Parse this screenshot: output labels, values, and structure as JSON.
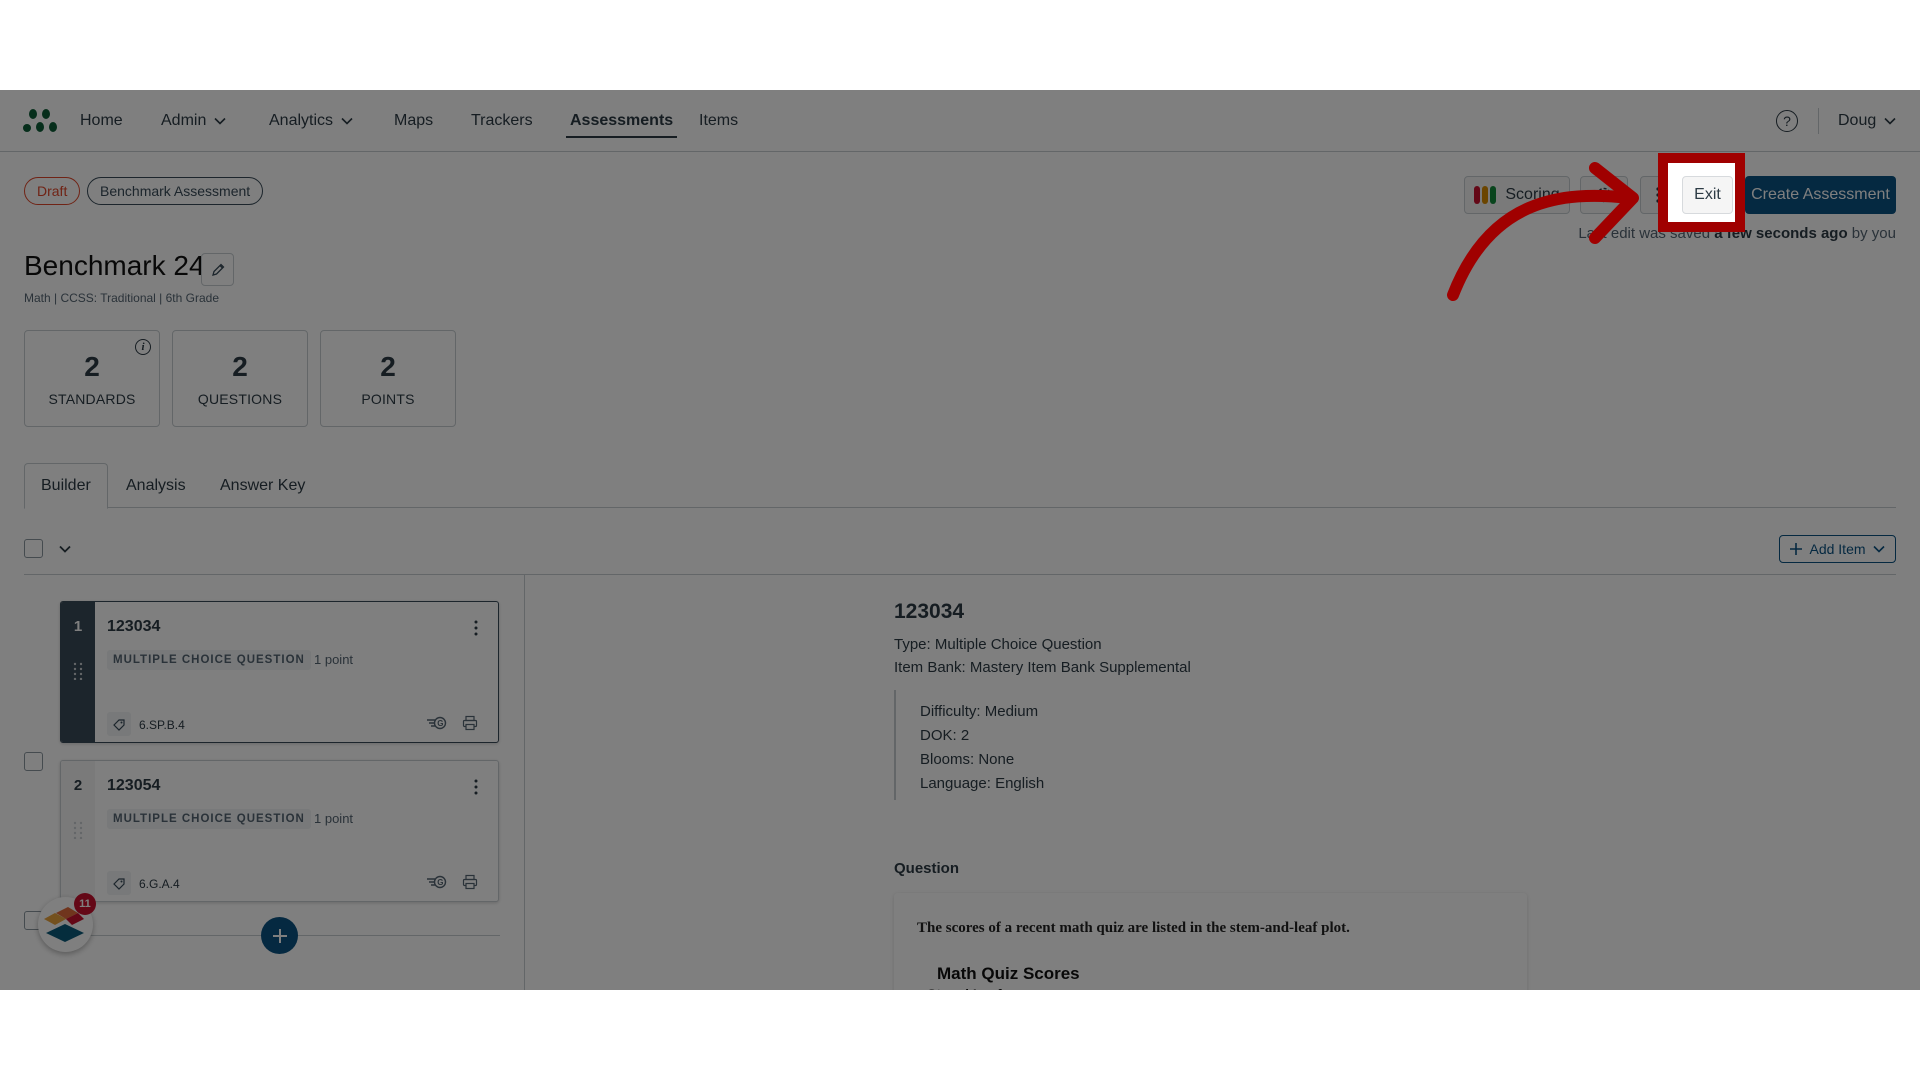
{
  "nav": {
    "items": [
      {
        "label": "Home",
        "has_dropdown": false,
        "active": false
      },
      {
        "label": "Admin",
        "has_dropdown": true,
        "active": false
      },
      {
        "label": "Analytics",
        "has_dropdown": true,
        "active": false
      },
      {
        "label": "Maps",
        "has_dropdown": false,
        "active": false
      },
      {
        "label": "Trackers",
        "has_dropdown": false,
        "active": false
      },
      {
        "label": "Assessments",
        "has_dropdown": false,
        "active": true
      },
      {
        "label": "Items",
        "has_dropdown": false,
        "active": false
      }
    ],
    "help_icon": "?",
    "user": "Doug",
    "brand_color": "#0d5c36"
  },
  "header": {
    "status_badge": "Draft",
    "type_badge": "Benchmark Assessment",
    "title": "Benchmark 24",
    "subtitle": "Math  |  CCSS: Traditional  |  6th Grade",
    "actions": {
      "scoring": "Scoring",
      "exit": "Exit",
      "create": "Create Assessment"
    },
    "saved_prefix": "Last edit was saved ",
    "saved_bold": "a few seconds ago",
    "saved_suffix": " by you"
  },
  "stats": [
    {
      "value": "2",
      "label": "STANDARDS",
      "has_info": true
    },
    {
      "value": "2",
      "label": "QUESTIONS",
      "has_info": false
    },
    {
      "value": "2",
      "label": "POINTS",
      "has_info": false
    }
  ],
  "tabs": [
    {
      "label": "Builder",
      "active": true
    },
    {
      "label": "Analysis",
      "active": false
    },
    {
      "label": "Answer Key",
      "active": false
    }
  ],
  "toolbar": {
    "add_item": "Add Item"
  },
  "items": [
    {
      "index": "1",
      "id": "123034",
      "type": "MULTIPLE CHOICE QUESTION",
      "points": "1 point",
      "standard": "6.SP.B.4",
      "selected": true
    },
    {
      "index": "2",
      "id": "123054",
      "type": "MULTIPLE CHOICE QUESTION",
      "points": "1 point",
      "standard": "6.G.A.4",
      "selected": false
    }
  ],
  "notification_count": "11",
  "detail": {
    "id": "123034",
    "type": "Type: Multiple Choice Question",
    "bank": "Item Bank: Mastery Item Bank Supplemental",
    "meta": [
      "Difficulty: Medium",
      "DOK: 2",
      "Blooms: None",
      "Language: English"
    ],
    "question_label": "Question",
    "question_text": "The scores of a recent math quiz are listed in the stem-and-leaf plot.",
    "plot_title": "Math Quiz Scores",
    "plot_header": "Stem  |  Leaf"
  },
  "annotation": {
    "highlight_target": "Exit",
    "color": "#a00000"
  }
}
